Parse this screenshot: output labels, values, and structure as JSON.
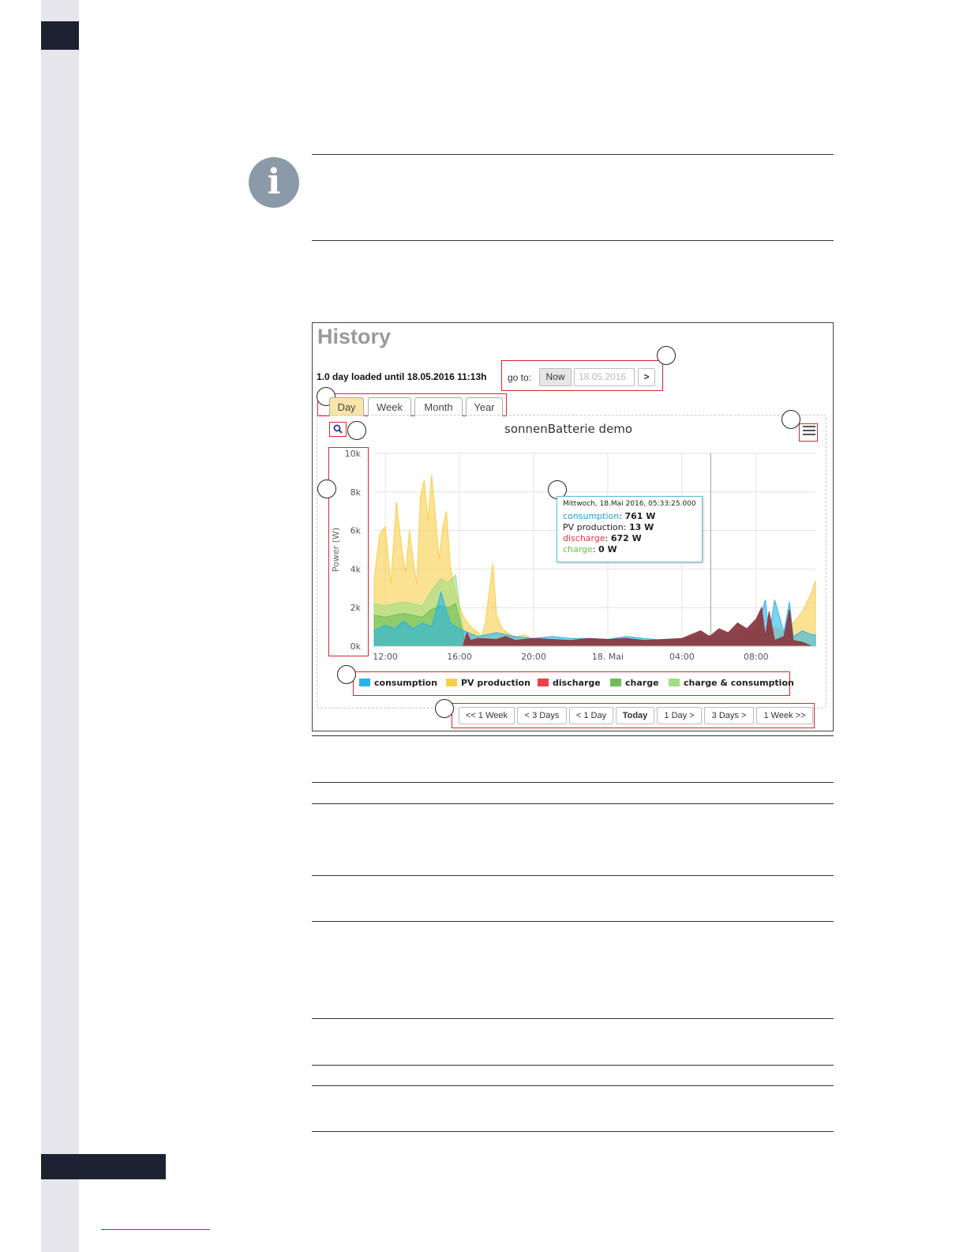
{
  "screenshot": {
    "history_title": "History",
    "loaded_text": "1.0 day loaded until 18.05.2016 11:13h",
    "goto": {
      "label": "go to:",
      "now_label": "Now",
      "date_placeholder": "18.05.2016",
      "go_label": ">"
    },
    "tabs": [
      "Day",
      "Week",
      "Month",
      "Year"
    ],
    "active_tab": "Day",
    "chart_title": "sonnenBatterie demo",
    "navigation": [
      "<< 1 Week",
      "< 3 Days",
      "< 1 Day",
      "Today",
      "1 Day >",
      "3 Days >",
      "1 Week >>"
    ],
    "tooltip": {
      "header": "Mittwoch, 18.Mai 2016, 05:33:25.000",
      "rows": [
        {
          "name": "consumption",
          "value": "761 W",
          "color": "#1ba1d8"
        },
        {
          "name": "PV production",
          "value": "13 W",
          "color": "#222222"
        },
        {
          "name": "discharge",
          "value": "672 W",
          "color": "#e8363d"
        },
        {
          "name": "charge",
          "value": "0 W",
          "color": "#6cc04a"
        }
      ]
    },
    "legend": [
      {
        "name": "consumption",
        "color": "#29b4e8"
      },
      {
        "name": "PV production",
        "color": "#f9cf4a"
      },
      {
        "name": "discharge",
        "color": "#ef3e45"
      },
      {
        "name": "charge",
        "color": "#6cbf55"
      },
      {
        "name": "charge & consumption",
        "color": "#9fde86"
      }
    ]
  },
  "chart_data": {
    "type": "area",
    "title": "sonnenBatterie demo",
    "ylabel": "Power (W)",
    "xlabel": "",
    "y_ticks": [
      "0k",
      "2k",
      "4k",
      "6k",
      "8k",
      "10k"
    ],
    "ylim": [
      0,
      10000
    ],
    "x_ticks": [
      "12:00",
      "16:00",
      "20:00",
      "18. Mai",
      "04:00",
      "08:00"
    ],
    "x_unit": "hours since 12:00 on 17. Mai",
    "xlim": [
      -0.6,
      23.2
    ],
    "grid": true,
    "legend_position": "bottom",
    "series": [
      {
        "name": "PV production",
        "color": "#f9cf4a",
        "x": [
          -0.6,
          -0.3,
          0,
          0.3,
          0.6,
          0.9,
          1.1,
          1.3,
          1.5,
          1.7,
          1.9,
          2.1,
          2.3,
          2.5,
          2.7,
          2.9,
          3.1,
          3.3,
          3.5,
          3.7,
          3.9,
          4.1,
          4.3,
          4.6,
          4.9,
          5.2,
          5.4,
          5.6,
          5.8,
          6.0,
          6.3,
          6.6,
          7.0,
          7.5,
          8.0,
          9,
          10,
          11,
          12,
          13,
          14,
          15,
          16,
          17,
          18,
          18.5,
          19,
          19.5,
          20,
          20.5,
          21,
          21.5,
          22,
          22.5,
          23,
          23.2
        ],
        "values": [
          3500,
          5800,
          6200,
          3200,
          7500,
          5000,
          3800,
          6000,
          4500,
          3200,
          7800,
          8600,
          6500,
          8900,
          6800,
          4500,
          6200,
          7000,
          4200,
          3200,
          2400,
          1800,
          1400,
          1000,
          800,
          500,
          1200,
          2800,
          4300,
          1600,
          900,
          700,
          450,
          600,
          300,
          250,
          200,
          150,
          120,
          100,
          80,
          60,
          50,
          40,
          80,
          200,
          350,
          600,
          900,
          700,
          1000,
          700,
          1200,
          1800,
          2800,
          3400
        ]
      },
      {
        "name": "charge & consumption",
        "color": "#9fde86",
        "x": [
          -0.6,
          0,
          1,
          2,
          2.5,
          3.0,
          3.4,
          3.8,
          4.0,
          4.2,
          4.3
        ],
        "values": [
          2200,
          2100,
          2300,
          2100,
          2900,
          3500,
          3300,
          3700,
          2000,
          900,
          0
        ]
      },
      {
        "name": "charge",
        "color": "#6cbf55",
        "x": [
          -0.6,
          0,
          1,
          2,
          2.5,
          3.0,
          3.4,
          3.8,
          4.0,
          4.2,
          4.3
        ],
        "values": [
          1600,
          1500,
          1700,
          1500,
          1900,
          2100,
          2000,
          2200,
          1400,
          600,
          0
        ]
      },
      {
        "name": "consumption",
        "color": "#29b4e8",
        "x": [
          -0.6,
          0,
          0.5,
          1,
          1.5,
          2,
          2.5,
          3,
          3.5,
          4,
          4.5,
          5,
          6,
          7,
          8,
          9,
          10,
          11,
          12,
          13,
          14,
          15,
          16,
          17,
          18,
          19,
          20,
          20.5,
          20.7,
          21,
          21.5,
          21.8,
          22,
          22.5,
          23,
          23.2
        ],
        "values": [
          800,
          1100,
          900,
          1300,
          900,
          1200,
          1000,
          2800,
          1200,
          900,
          700,
          500,
          700,
          500,
          400,
          500,
          400,
          400,
          350,
          500,
          400,
          300,
          400,
          500,
          600,
          800,
          700,
          2400,
          500,
          2400,
          700,
          2300,
          500,
          800,
          600,
          600
        ]
      },
      {
        "name": "discharge",
        "color": "#8b3a42",
        "x": [
          4.2,
          4.4,
          4.6,
          5,
          6,
          6.5,
          7,
          8,
          9,
          10,
          11,
          12,
          13,
          14,
          15,
          16,
          17,
          17.5,
          18,
          18.5,
          19,
          19.5,
          20,
          20.3,
          20.5,
          20.7,
          21,
          21.5,
          21.8,
          22,
          22.5,
          23
        ],
        "values": [
          0,
          700,
          300,
          400,
          350,
          500,
          300,
          400,
          350,
          300,
          400,
          350,
          400,
          300,
          350,
          400,
          800,
          500,
          900,
          700,
          1200,
          900,
          1400,
          2000,
          500,
          1800,
          300,
          500,
          1900,
          300,
          200,
          0
        ]
      }
    ]
  }
}
